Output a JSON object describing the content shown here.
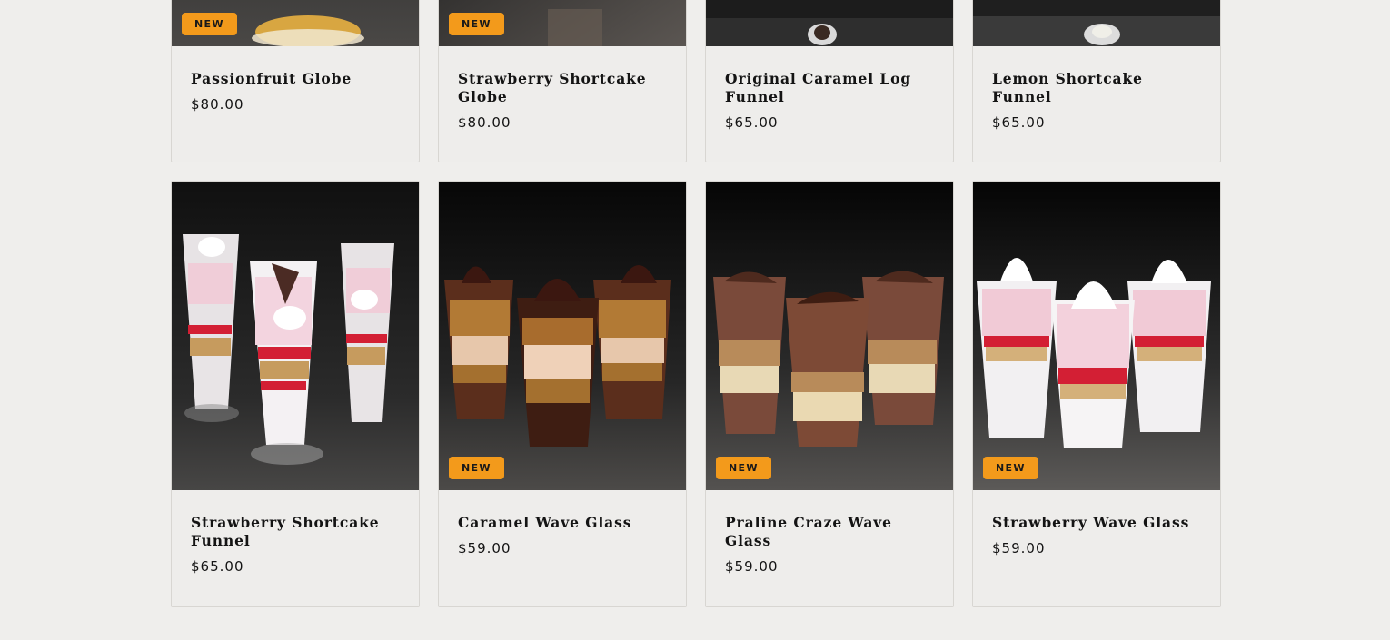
{
  "products": [
    {
      "name": "Passionfruit Globe",
      "price": "$80.00",
      "badge": "NEW",
      "image": "passionfruit-globe-dessert"
    },
    {
      "name": "Strawberry Shortcake Globe",
      "price": "$80.00",
      "badge": "NEW",
      "image": "strawberry-shortcake-globe-dessert"
    },
    {
      "name": "Original Caramel Log Funnel",
      "price": "$65.00",
      "badge": "",
      "image": "caramel-log-funnel-dessert"
    },
    {
      "name": "Lemon Shortcake Funnel",
      "price": "$65.00",
      "badge": "",
      "image": "lemon-shortcake-funnel-dessert"
    },
    {
      "name": "Strawberry Shortcake Funnel",
      "price": "$65.00",
      "badge": "",
      "image": "strawberry-shortcake-funnel-dessert"
    },
    {
      "name": "Caramel Wave Glass",
      "price": "$59.00",
      "badge": "NEW",
      "image": "caramel-wave-glass-dessert"
    },
    {
      "name": "Praline Craze Wave Glass",
      "price": "$59.00",
      "badge": "NEW",
      "image": "praline-wave-glass-dessert"
    },
    {
      "name": "Strawberry Wave Glass",
      "price": "$59.00",
      "badge": "NEW",
      "image": "strawberry-wave-glass-dessert"
    }
  ],
  "colors": {
    "badge": "#f39a1b",
    "background": "#efeeec"
  }
}
